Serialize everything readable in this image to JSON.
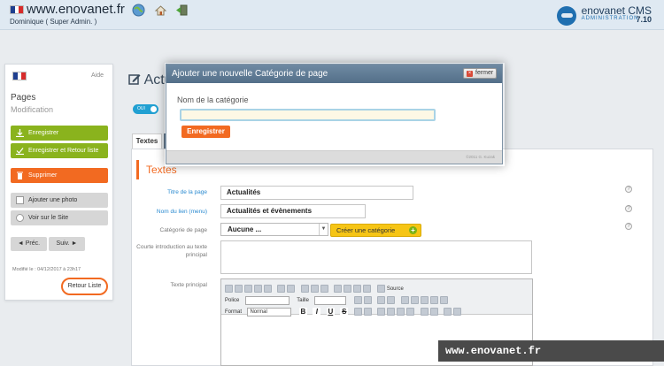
{
  "header": {
    "site_url": "www.enovanet.fr",
    "user": "Dominique ( Super Admin. )",
    "brand_name": "enovanet CMS",
    "brand_sub": "ADMINISTRATION",
    "brand_version": "7.10"
  },
  "sidebar": {
    "help": "Aide",
    "title": "Pages",
    "subtitle": "Modification",
    "buttons": [
      {
        "label": "Enregistrer"
      },
      {
        "label": "Enregistrer et Retour liste"
      },
      {
        "label": "Supprimer"
      },
      {
        "label": "Ajouter une photo"
      },
      {
        "label": "Voir sur le Site"
      }
    ],
    "prev": "◄ Préc.",
    "next": "Suiv. ►",
    "modified": "Modifié le : 04/12/2017 à 23h17",
    "back": "Retour Liste"
  },
  "main": {
    "page_title": "Actu",
    "toggle_label": "OUI",
    "tab_textes": "Textes",
    "section_title": "Textes",
    "fields": {
      "title_label": "Titre de la page",
      "title_value": "Actualités",
      "link_label": "Nom du lien (menu)",
      "link_value": "Actualités et évènements",
      "category_label": "Catégorie de page",
      "category_value": "Aucune ...",
      "create_category": "Créer une catégorie",
      "intro_label": "Courte introduction au texte principal",
      "text_label": "Texte principal"
    },
    "editor": {
      "source": "Source",
      "police_label": "Police",
      "taille_label": "Taille",
      "format_label": "Format",
      "format_value": "Normal",
      "bold": "B",
      "italic": "I",
      "underline": "U",
      "strike": "S"
    },
    "help_mark": "?"
  },
  "modal": {
    "title": "Ajouter une nouvelle Catégorie de page",
    "close": "fermer",
    "label": "Nom de la catégorie",
    "input_value": "",
    "save": "Enregistrer",
    "copyright": "©2011 G. Kuzak"
  },
  "watermark": "www.enovanet.fr",
  "colors": {
    "accent_orange": "#f26a21",
    "accent_green": "#8ab31d",
    "accent_blue": "#2a8ad0",
    "modal_header": "#5f7b95"
  }
}
